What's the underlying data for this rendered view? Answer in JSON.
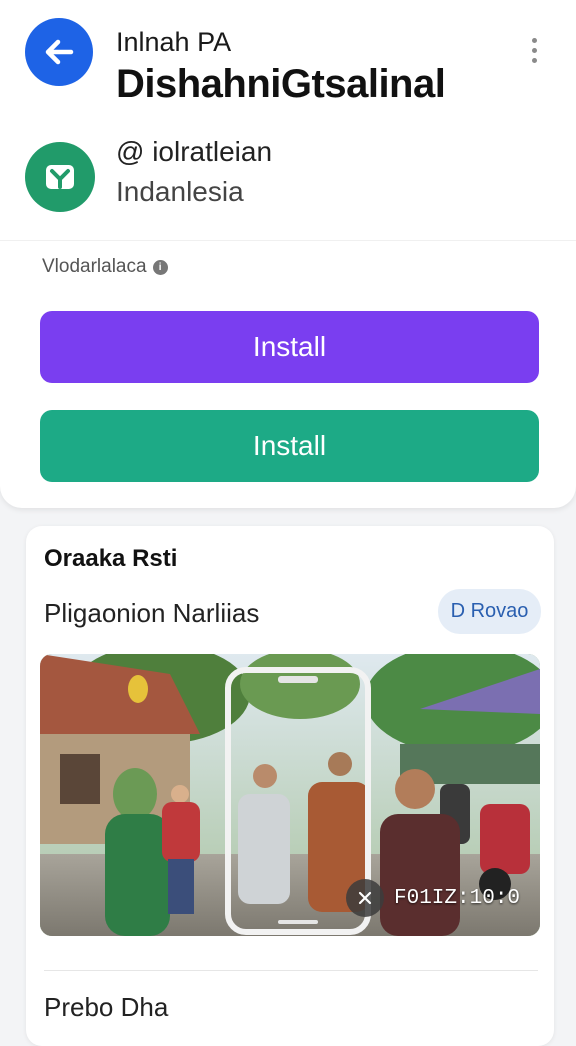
{
  "header": {
    "back_icon": "arrow-left-icon",
    "small_title": "Inlnah PA",
    "title": "DishahniGtsalinal",
    "more_icon": "more-vertical-icon"
  },
  "developer": {
    "logo_icon": "leaf-logo-icon",
    "handle": "@ iolrаtleiаn",
    "country": "Indanlesia"
  },
  "meta": {
    "text": "Vlodarlalaca",
    "info_icon": "info-icon"
  },
  "buttons": {
    "primary_label": "Install",
    "secondary_label": "Install"
  },
  "colors": {
    "back_button": "#1e63e6",
    "primary_button": "#7a3ef0",
    "secondary_button": "#1daa86",
    "logo": "#219b6a"
  },
  "section": {
    "title": "Oraaka Rsti",
    "subtitle": "Pligaonion Narliias",
    "chip": "D Rovao"
  },
  "media": {
    "description_icon": "video-thumbnail",
    "play_icon": "play-icon",
    "duration": "F01IZ:10:0"
  },
  "bottom": {
    "label": "Prebo Dha"
  }
}
